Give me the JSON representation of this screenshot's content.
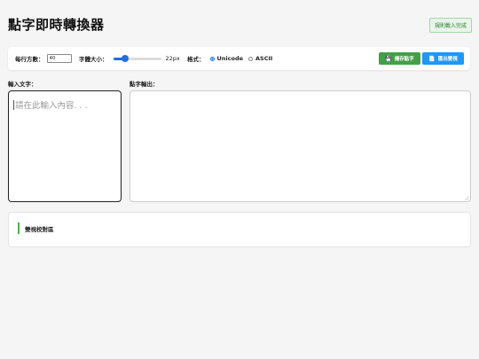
{
  "header": {
    "title": "點字即時轉換器",
    "status_badge": "規則載入完成"
  },
  "toolbar": {
    "cells_per_line_label": "每行方數：",
    "cells_per_line_value": "40",
    "font_size_label": "字體大小：",
    "font_size_value": "22px",
    "font_size_slider_fraction": 0.25,
    "format_label": "格式：",
    "format_options": [
      {
        "label": "Unicode",
        "checked": true
      },
      {
        "label": "ASCII",
        "checked": false
      }
    ],
    "save_button": {
      "label": "儲存點字",
      "icon": "save-icon"
    },
    "export_button": {
      "label": "匯出雙視",
      "icon": "document-icon"
    }
  },
  "input": {
    "label": "輸入文字：",
    "placeholder": "請在此輸入內容. . ."
  },
  "output": {
    "label": "點字輸出："
  },
  "preview": {
    "title": "雙視校對區"
  },
  "colors": {
    "accent_blue": "#2196f3",
    "accent_green": "#43a047",
    "slider": "#1e6fe0",
    "badge_green": "#2e7d32"
  }
}
